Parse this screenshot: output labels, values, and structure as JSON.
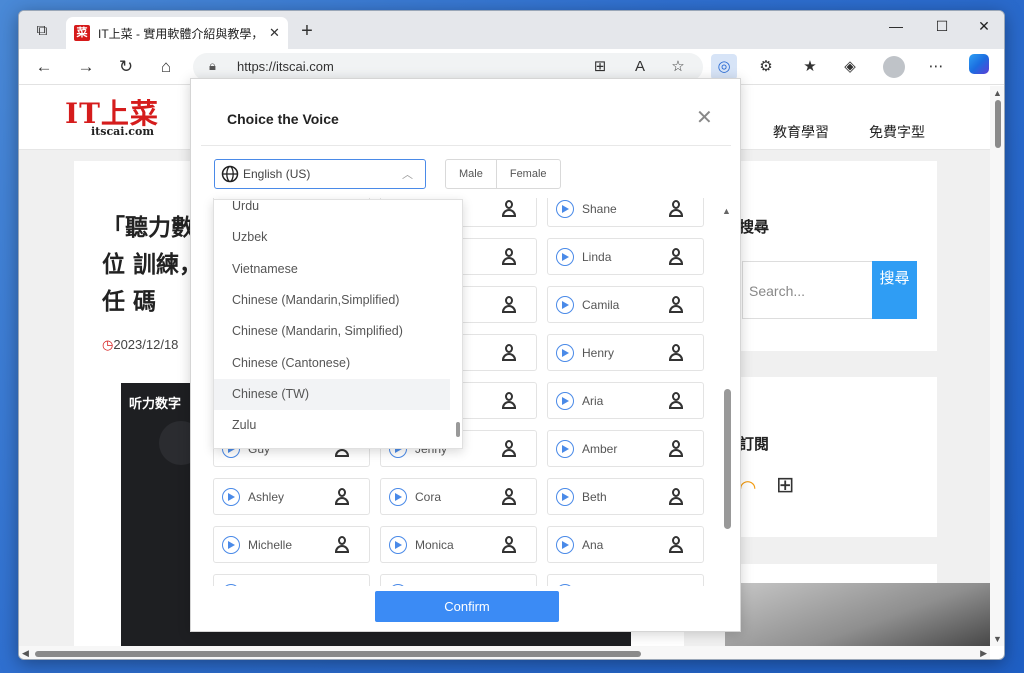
{
  "browser": {
    "tab_title": "IT上菜 - 實用軟體介紹與教學，更",
    "tab_favicon": "菜",
    "url": "https://itscai.com",
    "window_controls": [
      "—",
      "☐",
      "✕"
    ],
    "new_tab": "+",
    "tab_close": "✕"
  },
  "site": {
    "logo": "IT上菜",
    "logo_sub": "itscai.com",
    "nav": [
      "教育學習",
      "免費字型"
    ],
    "article_title": "「聽力數位 訓練，任 碼",
    "article_date": "2023/12/18",
    "article_image_text": "听力数字",
    "side_heading_search": "搜尋",
    "search_placeholder": "Search...",
    "search_button": "搜尋",
    "side_heading_subscribe": "訂閱"
  },
  "modal": {
    "title": "Choice the Voice",
    "language_value": "English (US)",
    "gender_buttons": [
      "Male",
      "Female"
    ],
    "confirm_label": "Confirm",
    "languages": [
      "Urdu",
      "Uzbek",
      "Vietnamese",
      "Chinese (Mandarin,Simplified)",
      "Chinese (Mandarin, Simplified)",
      "Chinese (Cantonese)",
      "Chinese (TW)",
      "Zulu"
    ],
    "selected_language": "Chinese (TW)",
    "voices": [
      [
        "",
        "",
        "Shane"
      ],
      [
        "",
        "",
        "Linda"
      ],
      [
        "",
        "",
        "Camila"
      ],
      [
        "",
        "",
        "Henry"
      ],
      [
        "",
        "",
        "Aria"
      ],
      [
        "Guy",
        "Jenny",
        "Amber"
      ],
      [
        "Ashley",
        "Cora",
        "Beth"
      ],
      [
        "Michelle",
        "Monica",
        "Ana"
      ],
      [
        "",
        "",
        ""
      ]
    ]
  },
  "colors": {
    "accent": "#3b8bf5",
    "brand_red": "#d51c1c"
  }
}
